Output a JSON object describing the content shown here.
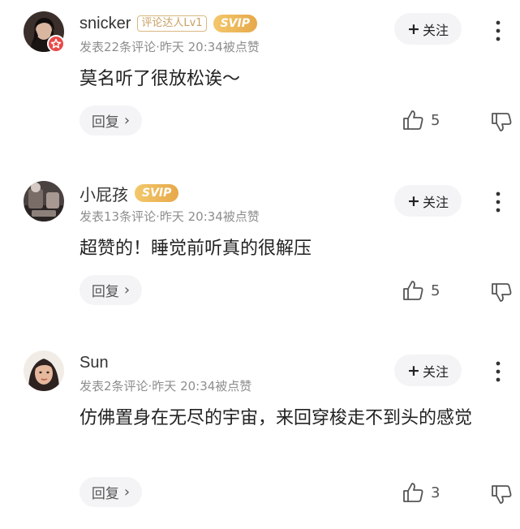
{
  "comments": [
    {
      "username": "snicker",
      "level_tag": "评论达人Lv1",
      "svip_tag": "SVIP",
      "meta": "发表22条评论·昨天 20:34被点赞",
      "follow_label": "关注",
      "text": "莫名听了很放松诶～",
      "reply_label": "回复",
      "likes": "5"
    },
    {
      "username": "小屁孩",
      "svip_tag": "SVIP",
      "meta": "发表13条评论·昨天 20:34被点赞",
      "follow_label": "关注",
      "text": "超赞的！睡觉前听真的很解压",
      "reply_label": "回复",
      "likes": "5"
    },
    {
      "username": "Sun",
      "meta": "发表2条评论·昨天 20:34被点赞",
      "follow_label": "关注",
      "text": "仿佛置身在无尽的宇宙，来回穿梭走不到头的感觉",
      "reply_label": "回复",
      "likes": "3"
    }
  ],
  "colors": {
    "accent_gold": "#e6a84a",
    "badge_red": "#e84a4a",
    "button_bg": "#f4f4f6",
    "meta_gray": "#8e8e8e"
  }
}
